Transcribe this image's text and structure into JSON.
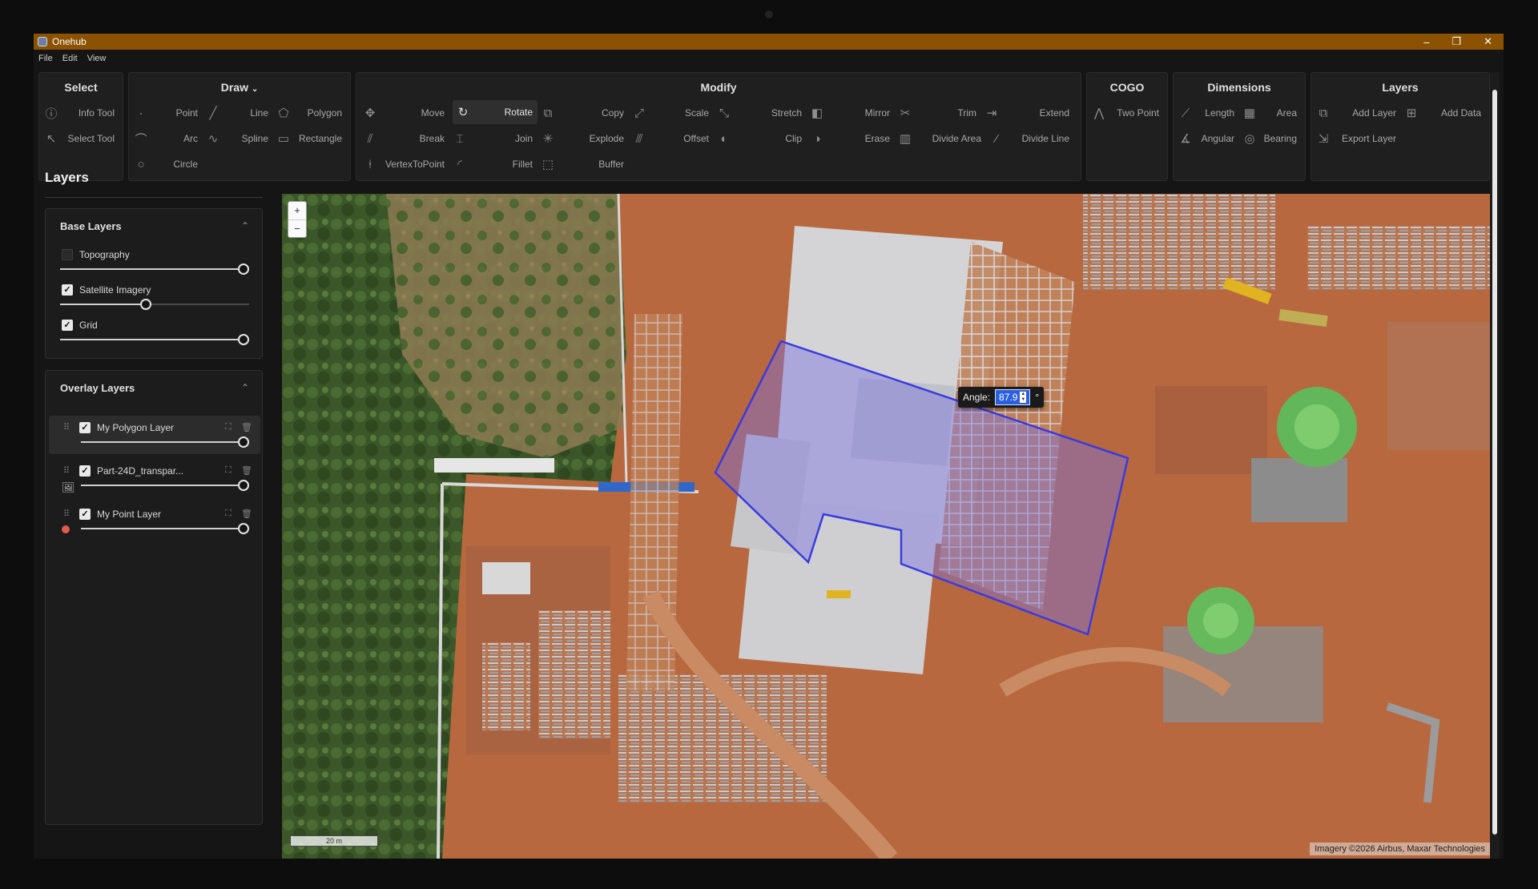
{
  "window": {
    "title": "Onehub",
    "controls": [
      "–",
      "❐",
      "✕"
    ]
  },
  "menu": [
    "File",
    "Edit",
    "View"
  ],
  "ribbon": {
    "select": {
      "title": "Select",
      "tools": [
        {
          "label": "Info Tool",
          "icon": "info-icon"
        },
        {
          "label": "Select Tool",
          "icon": "cursor-icon"
        }
      ]
    },
    "draw": {
      "title": "Draw",
      "tools": [
        {
          "label": "Point",
          "icon": "point-icon"
        },
        {
          "label": "Line",
          "icon": "line-icon"
        },
        {
          "label": "Polygon",
          "icon": "polygon-icon"
        },
        {
          "label": "Arc",
          "icon": "arc-icon"
        },
        {
          "label": "Spline",
          "icon": "spline-icon"
        },
        {
          "label": "Rectangle",
          "icon": "rectangle-icon"
        },
        {
          "label": "Circle",
          "icon": "circle-icon"
        }
      ]
    },
    "modify": {
      "title": "Modify",
      "tools": [
        {
          "label": "Move",
          "icon": "move-icon"
        },
        {
          "label": "Rotate",
          "icon": "rotate-icon"
        },
        {
          "label": "Copy",
          "icon": "copy-icon"
        },
        {
          "label": "Scale",
          "icon": "scale-icon"
        },
        {
          "label": "Stretch",
          "icon": "stretch-icon"
        },
        {
          "label": "Mirror",
          "icon": "mirror-icon"
        },
        {
          "label": "Trim",
          "icon": "scissors-icon"
        },
        {
          "label": "Extend",
          "icon": "extend-icon"
        },
        {
          "label": "Break",
          "icon": "break-icon"
        },
        {
          "label": "Join",
          "icon": "join-icon"
        },
        {
          "label": "Explode",
          "icon": "explode-icon"
        },
        {
          "label": "Offset",
          "icon": "offset-icon"
        },
        {
          "label": "Clip",
          "icon": "clip-icon"
        },
        {
          "label": "Erase",
          "icon": "erase-icon"
        },
        {
          "label": "Divide Area",
          "icon": "divide-area-icon"
        },
        {
          "label": "Divide Line",
          "icon": "divide-line-icon"
        },
        {
          "label": "VertexToPoint",
          "icon": "vertex-icon"
        },
        {
          "label": "Fillet",
          "icon": "fillet-icon"
        },
        {
          "label": "Buffer",
          "icon": "buffer-icon"
        }
      ]
    },
    "cogo": {
      "title": "COGO",
      "tools": [
        {
          "label": "Two Point",
          "icon": "two-point-icon"
        }
      ]
    },
    "dimensions": {
      "title": "Dimensions",
      "tools": [
        {
          "label": "Length",
          "icon": "ruler-icon"
        },
        {
          "label": "Area",
          "icon": "area-icon"
        },
        {
          "label": "Angular",
          "icon": "angle-icon"
        },
        {
          "label": "Bearing",
          "icon": "compass-icon"
        }
      ]
    },
    "layers": {
      "title": "Layers",
      "tools": [
        {
          "label": "Add Layer",
          "icon": "add-layer-icon"
        },
        {
          "label": "Add Data",
          "icon": "add-data-icon"
        },
        {
          "label": "Export Layer",
          "icon": "export-icon"
        }
      ]
    }
  },
  "layers_panel": {
    "title": "Layers",
    "base": {
      "title": "Base Layers",
      "items": [
        {
          "name": "Topography",
          "checked": false,
          "opacity": 1.0
        },
        {
          "name": "Satellite Imagery",
          "checked": true,
          "opacity": 0.45
        },
        {
          "name": "Grid",
          "checked": true,
          "opacity": 1.0
        }
      ]
    },
    "overlay": {
      "title": "Overlay Layers",
      "items": [
        {
          "name": "My Polygon Layer",
          "checked": true,
          "opacity": 1.0,
          "selected": true
        },
        {
          "name": "Part-24D_transpar...",
          "checked": true,
          "opacity": 1.0
        },
        {
          "name": "My Point Layer",
          "checked": true,
          "opacity": 1.0
        }
      ]
    }
  },
  "map": {
    "zoom_in": "+",
    "zoom_out": "−",
    "scale_label": "20 m",
    "attribution": "Imagery ©2026 Airbus, Maxar Technologies",
    "angle_label": "Angle:",
    "angle_value": "87.9",
    "angle_unit": "°"
  },
  "colors": {
    "titlebar": "#8a5202",
    "polygon": "#3a3adf",
    "ground": "#b5653f",
    "forest": "#3f5a2c"
  }
}
